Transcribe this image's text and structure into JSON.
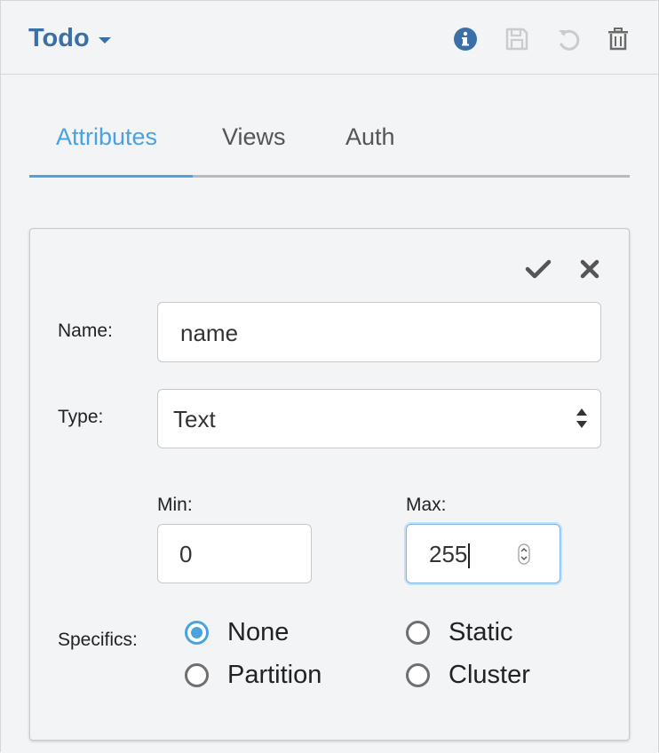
{
  "header": {
    "title": "Todo",
    "icons": {
      "info": "info-circle-icon",
      "save": "save-icon",
      "undo": "undo-icon",
      "delete": "trash-icon"
    }
  },
  "tabs": [
    {
      "label": "Attributes",
      "active": true
    },
    {
      "label": "Views",
      "active": false
    },
    {
      "label": "Auth",
      "active": false
    }
  ],
  "form": {
    "actions": {
      "confirm": "check-icon",
      "cancel": "close-icon"
    },
    "name": {
      "label": "Name:",
      "value": "name"
    },
    "type": {
      "label": "Type:",
      "value": "Text"
    },
    "min": {
      "label": "Min:",
      "value": "0"
    },
    "max": {
      "label": "Max:",
      "value": "255"
    },
    "specifics": {
      "label": "Specifics:",
      "options": [
        {
          "label": "None",
          "checked": true
        },
        {
          "label": "Static",
          "checked": false
        },
        {
          "label": "Partition",
          "checked": false
        },
        {
          "label": "Cluster",
          "checked": false
        }
      ]
    }
  },
  "colors": {
    "brand": "#3a6fa8",
    "accent": "#4aa3df",
    "background": "#f3f4f6"
  }
}
